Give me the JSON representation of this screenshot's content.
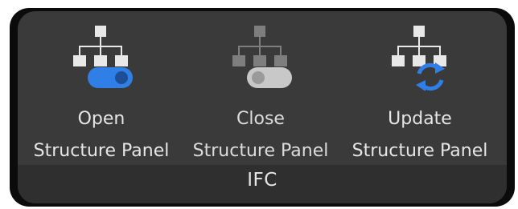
{
  "ribbon": {
    "group_label": "IFC",
    "buttons": [
      {
        "line1": "Open",
        "line2": "Structure Panel",
        "icon": "tree-toggle-on-icon"
      },
      {
        "line1": "Close",
        "line2": "Structure Panel",
        "icon": "tree-toggle-off-icon"
      },
      {
        "line1": "Update",
        "line2": "Structure Panel",
        "icon": "tree-refresh-icon"
      }
    ]
  },
  "colors": {
    "panel_bg": "#3a3a3a",
    "footer_bg": "#2f2f2f",
    "text": "#e6e6e6",
    "accent_blue": "#2f7fe6",
    "toggle_off": "#c8c8c8",
    "tree_light": "#e8e8e8",
    "tree_dim": "#8a8a8a"
  }
}
